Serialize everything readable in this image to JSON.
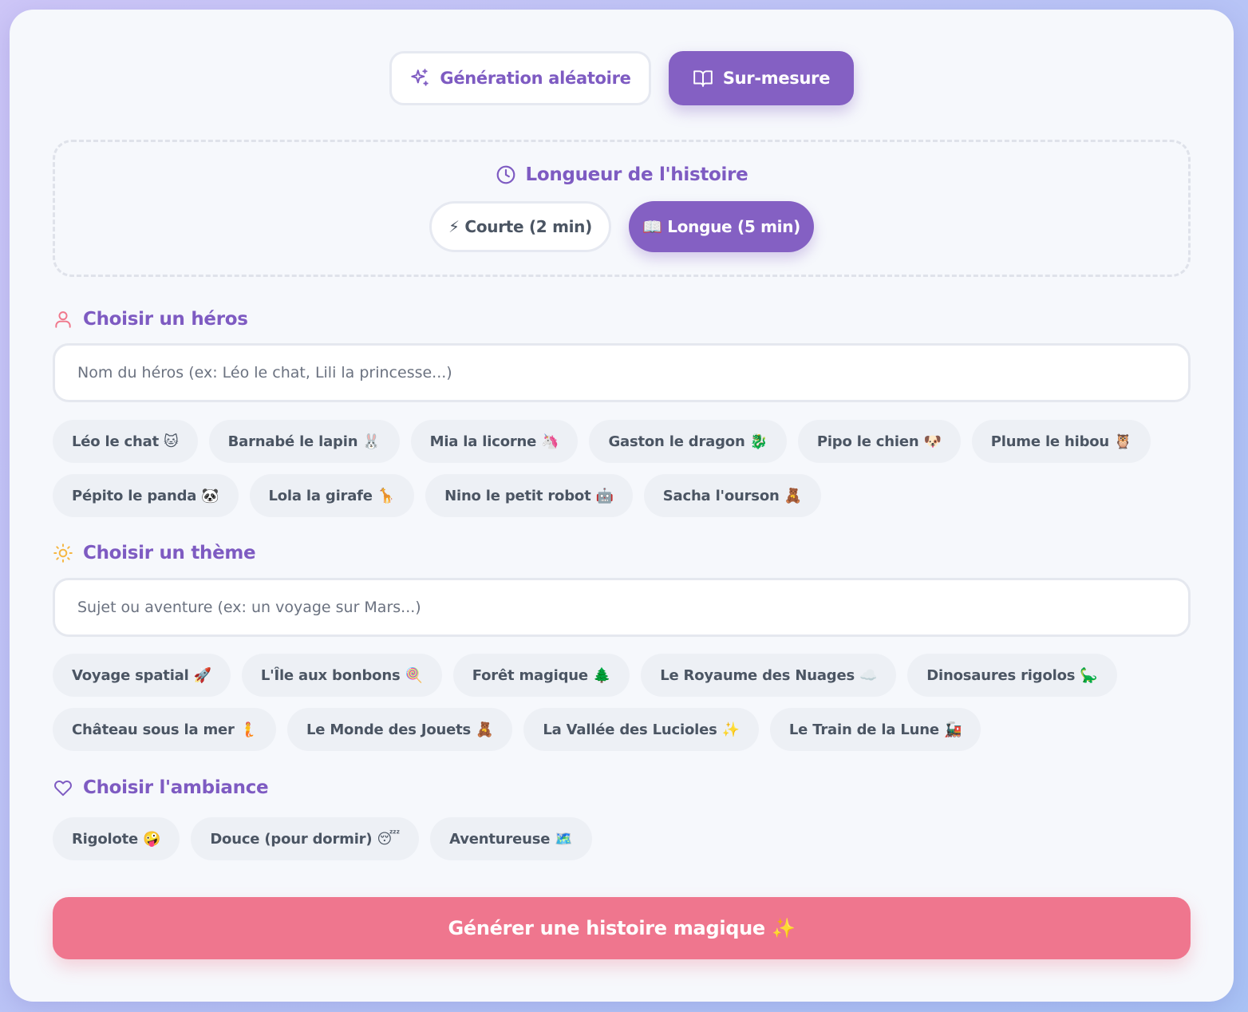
{
  "mode_tabs": {
    "random_label": "Génération aléatoire",
    "custom_label": "Sur-mesure"
  },
  "length": {
    "title": "Longueur de l'histoire",
    "short_label": "⚡ Courte (2 min)",
    "long_label": "📖 Longue (5 min)",
    "selected": "long"
  },
  "hero": {
    "title": "Choisir un héros",
    "placeholder": "Nom du héros (ex: Léo le chat, Lili la princesse...)",
    "value": "",
    "suggestions": [
      "Léo le chat 🐱",
      "Barnabé le lapin 🐰",
      "Mia la licorne 🦄",
      "Gaston le dragon 🐉",
      "Pipo le chien 🐶",
      "Plume le hibou 🦉",
      "Pépito le panda 🐼",
      "Lola la girafe 🦒",
      "Nino le petit robot 🤖",
      "Sacha l'ourson 🧸"
    ]
  },
  "theme": {
    "title": "Choisir un thème",
    "placeholder": "Sujet ou aventure (ex: un voyage sur Mars...)",
    "value": "",
    "suggestions": [
      "Voyage spatial 🚀",
      "L'Île aux bonbons 🍭",
      "Forêt magique 🌲",
      "Le Royaume des Nuages ☁️",
      "Dinosaures rigolos 🦕",
      "Château sous la mer 🧜",
      "Le Monde des Jouets 🧸",
      "La Vallée des Lucioles ✨",
      "Le Train de la Lune 🚂"
    ]
  },
  "mood": {
    "title": "Choisir l'ambiance",
    "options": [
      "Rigolote 🤪",
      "Douce (pour dormir) 😴",
      "Aventureuse 🗺️"
    ]
  },
  "generate_label": "Générer une histoire magique ✨",
  "colors": {
    "accent": "#8460c3",
    "title_purple": "#7e5bc2",
    "generate_pink": "#ef768e",
    "hero_icon": "#f0788c",
    "theme_icon": "#f5b642"
  },
  "icons": {
    "random": "sparkles-icon",
    "custom": "book-open-icon",
    "length": "clock-icon",
    "hero": "user-icon",
    "theme": "sun-icon",
    "mood": "heart-icon"
  }
}
